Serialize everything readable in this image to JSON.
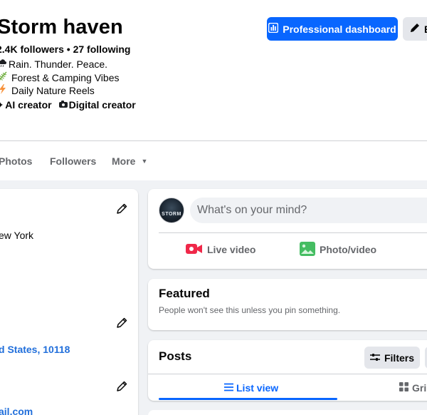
{
  "profile": {
    "name": "Storm haven",
    "stats": "2.4K followers • 27 following",
    "bio": [
      {
        "icon": "rain-cloud-icon",
        "text": "Rain. Thunder. Peace."
      },
      {
        "icon": "fern-icon",
        "text": "Forest & Camping Vibes"
      },
      {
        "icon": "lightning-icon",
        "text": "Daily Nature Reels"
      }
    ],
    "categories": [
      {
        "icon": "sparkles-icon",
        "label": "AI creator"
      },
      {
        "icon": "camera-icon",
        "label": "Digital creator"
      }
    ]
  },
  "actions": {
    "dashboard_label": "Professional dashboard",
    "edit_label": "E"
  },
  "tabs": {
    "photos": "Photos",
    "followers": "Followers",
    "more": "More"
  },
  "intro": {
    "city": "ew York",
    "zip": "d States, 10118",
    "email": "ail.com"
  },
  "composer": {
    "avatar_text": "STORM",
    "placeholder": "What's on your mind?",
    "live_video": "Live video",
    "photo_video": "Photo/video"
  },
  "featured": {
    "title": "Featured",
    "subtitle": "People won't see this unless you pin something."
  },
  "posts": {
    "title": "Posts",
    "filters": "Filters",
    "list_view": "List view",
    "grid_view": "Gri"
  },
  "colors": {
    "accent": "#0866ff",
    "live_red": "#f02849",
    "photo_green": "#45bd62",
    "link_blue": "#216fdb",
    "secondary_text": "#65676b"
  }
}
